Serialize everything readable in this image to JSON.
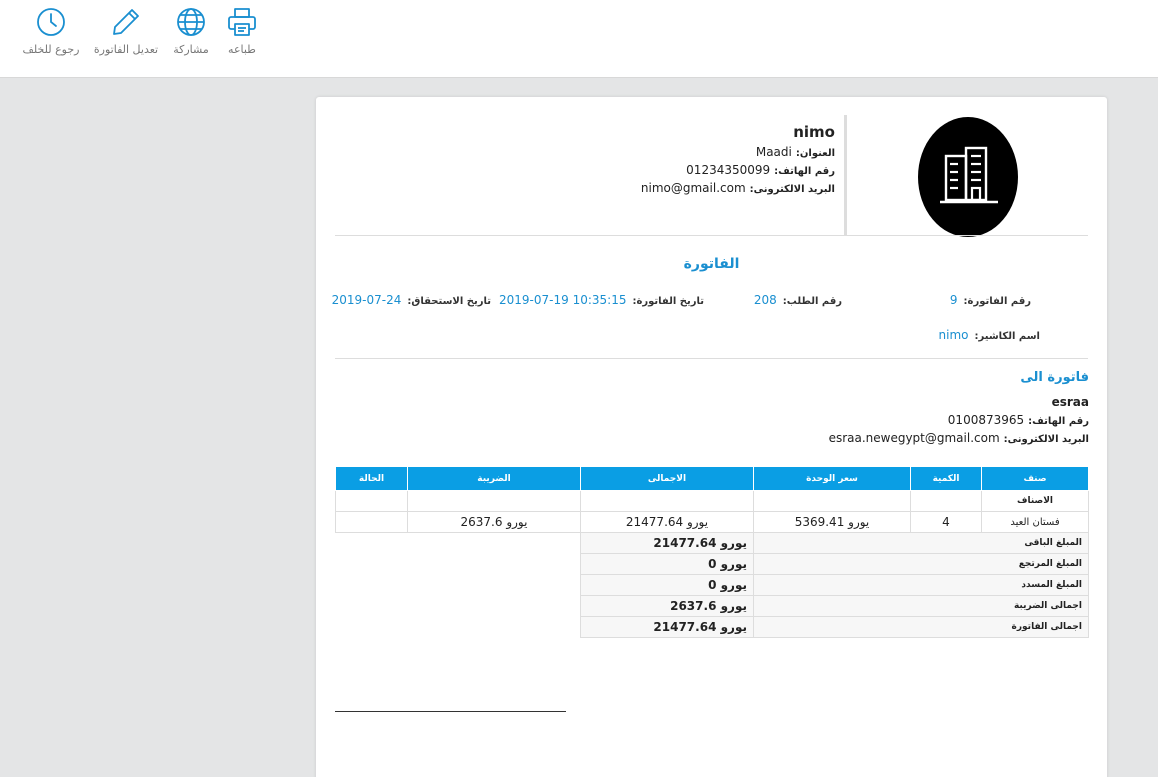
{
  "toolbar": {
    "print_label": "طباعه",
    "share_label": "مشاركة",
    "edit_label": "تعديل الفاتورة",
    "back_label": "رجوع للخلف",
    "icon_color": "#1a8fd0"
  },
  "shop": {
    "name": "nimo",
    "address_label": "العنوان:",
    "address": "Maadi",
    "phone_label": "رقم الهاتف:",
    "phone": "01234350099",
    "email_label": "البريد الالكترونى:",
    "email": "nimo@gmail.com"
  },
  "invoice": {
    "title": "الفاتورة",
    "number_label": "رقم الفاتورة:",
    "number": "9",
    "order_label": "رقم الطلب:",
    "order": "208",
    "date_label": "تاريخ الفاتورة:",
    "date": "2019-07-19 10:35:15",
    "due_label": "تاريخ الاستحقاق:",
    "due": "2019-07-24",
    "cashier_label": "اسم الكاشير:",
    "cashier": "nimo"
  },
  "bill_to": {
    "title": "فاتورة الى",
    "name": "esraa",
    "phone_label": "رقم الهاتف:",
    "phone": "0100873965",
    "email_label": "البريد الالكترونى:",
    "email": "esraa.newegypt@gmail.com"
  },
  "table": {
    "headers": {
      "item": "صنف",
      "qty": "الكمية",
      "unit_price": "سعر الوحدة",
      "total": "الاجمالى",
      "tax": "الضريبة",
      "status": "الحالة"
    },
    "category": "الاصناف",
    "rows": [
      {
        "item": "فستان العيد",
        "qty": "4",
        "unit_price": "يورو 5369.41",
        "total": "يورو 21477.64",
        "tax": "يورو 2637.6",
        "status": ""
      }
    ]
  },
  "summary": [
    {
      "label": "المبلغ الباقى",
      "value": "يورو 21477.64"
    },
    {
      "label": "المبلغ المرتجع",
      "value": "يورو 0"
    },
    {
      "label": "المبلغ المسدد",
      "value": "يورو 0"
    },
    {
      "label": "اجمالى الضريبة",
      "value": "يورو 2637.6"
    },
    {
      "label": "اجمالى الفاتورة",
      "value": "يورو 21477.64"
    }
  ]
}
